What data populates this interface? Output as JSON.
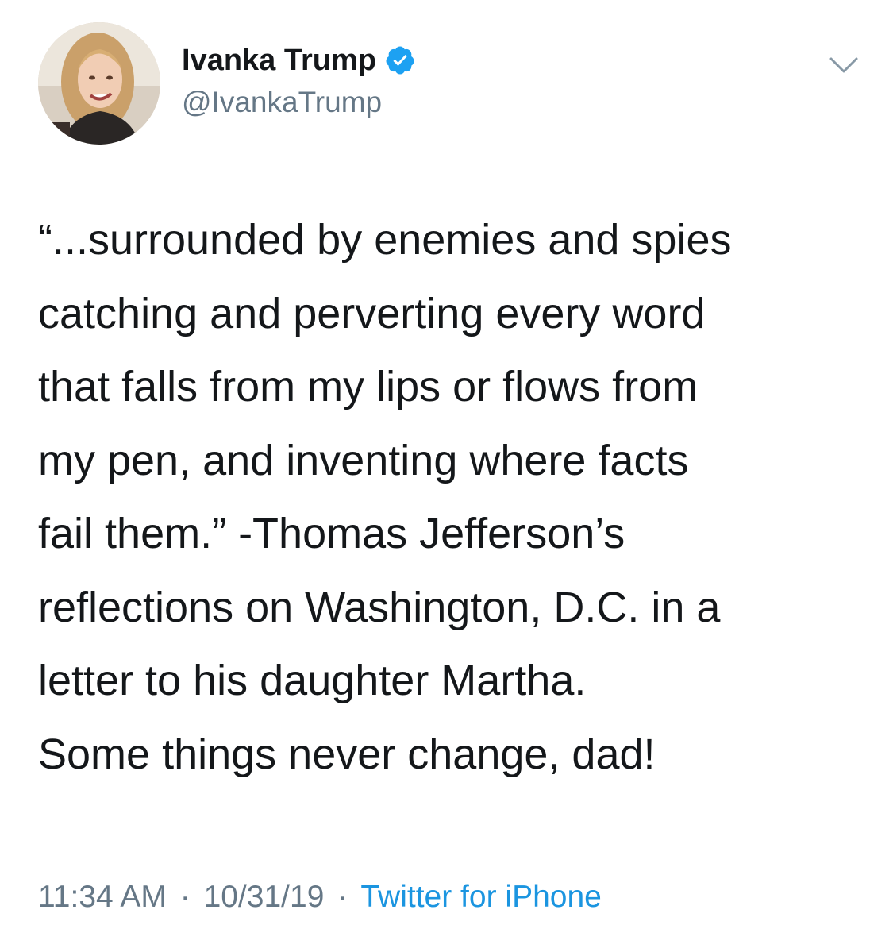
{
  "author": {
    "display_name": "Ivanka Trump",
    "handle": "@IvankaTrump",
    "verified": true,
    "avatar_icon": "profile-photo"
  },
  "menu": {
    "icon": "chevron-down-icon"
  },
  "tweet": {
    "text": "“...surrounded by enemies and spies\ncatching and perverting every word\nthat falls from my lips or flows from\nmy pen, and inventing where facts\nfail them.” -Thomas Jefferson’s\nreflections on Washington, D.C. in a\nletter to his daughter Martha.\nSome things never change, dad!"
  },
  "meta": {
    "time": "11:34 AM",
    "separator": "·",
    "date": "10/31/19",
    "source": "Twitter for iPhone"
  },
  "colors": {
    "text": "#14171a",
    "secondary": "#657786",
    "link": "#1b95e0",
    "verified_badge": "#1da1f2",
    "background": "#ffffff"
  }
}
